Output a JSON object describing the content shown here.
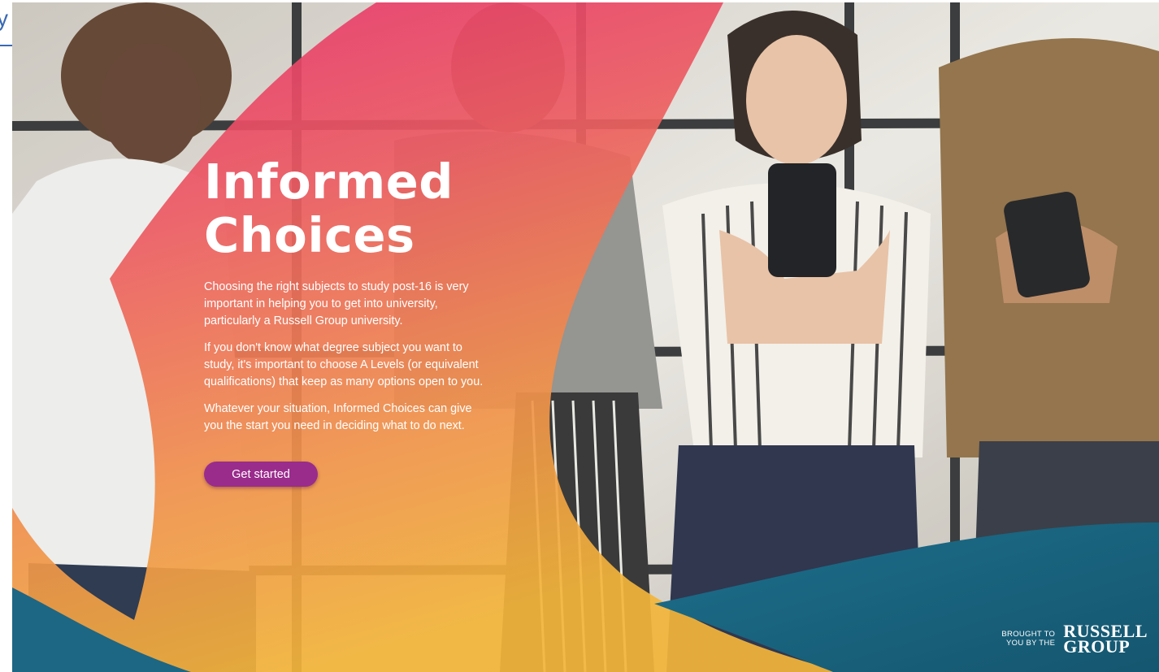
{
  "corner_link": {
    "text": "y"
  },
  "hero": {
    "title_line1": "Informed",
    "title_line2": "Choices",
    "paragraphs": [
      "Choosing the right subjects to study post-16 is very important in helping you to get into university, particularly a Russell Group university.",
      "If you don't know what degree subject you want to study, it's important to choose A Levels (or equivalent qualifications) that keep as many options open to you.",
      "Whatever your situation, Informed Choices can give you the start you need in deciding what to do next."
    ],
    "cta_label": "Get started"
  },
  "footer_brand": {
    "brought_line1": "BROUGHT TO",
    "brought_line2": "YOU BY THE",
    "logo_line1": "RUSSELL",
    "logo_line2": "GROUP"
  },
  "colors": {
    "pink": "#e8416f",
    "orange": "#f08a4b",
    "yellow": "#f2b33d",
    "teal": "#1d6784",
    "purple_button": "#9a2c8c",
    "link_blue": "#3a69b3"
  }
}
